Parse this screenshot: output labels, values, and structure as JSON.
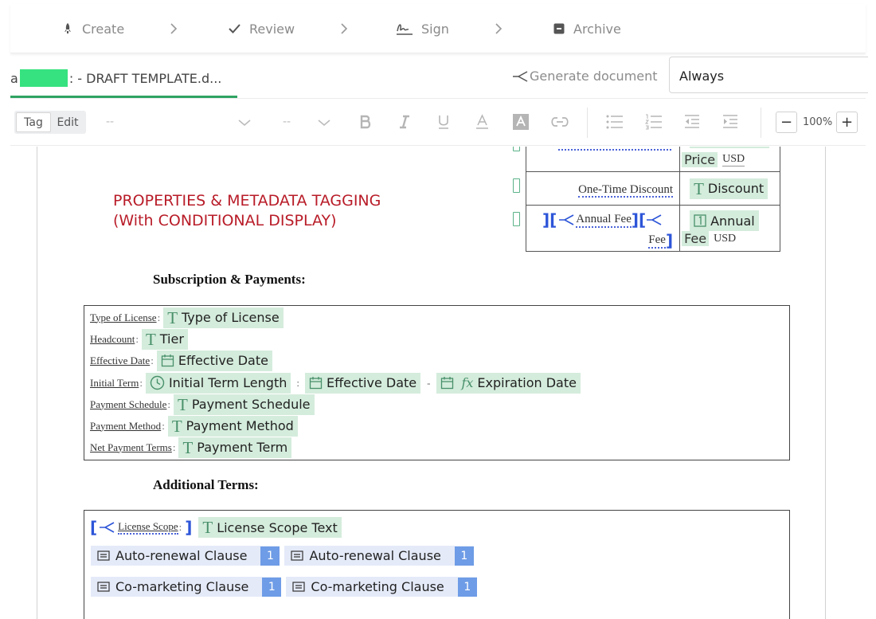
{
  "steps": [
    {
      "label": "Create",
      "icon": "rocket-icon"
    },
    {
      "label": "Review",
      "icon": "check-icon"
    },
    {
      "label": "Sign",
      "icon": "signature-icon"
    },
    {
      "label": "Archive",
      "icon": "archive-icon"
    }
  ],
  "filebar": {
    "file_prefix": "a",
    "file_name": ": - DRAFT TEMPLATE.d...",
    "generate_label": "Generate document",
    "condition_value": "Always"
  },
  "toolbar": {
    "mode_tag": "Tag",
    "mode_edit": "Edit",
    "font_family": "--",
    "font_size": "--",
    "zoom": "100%",
    "zoom_minus": "−",
    "zoom_plus": "+"
  },
  "doc": {
    "heading_line1": "PROPERTIES & METADATA TAGGING",
    "heading_line2": "(With CONDITIONAL DISPLAY)",
    "pricing_table": {
      "row1_tag_label": "Price",
      "row1_currency": "USD",
      "row2_label": "One-Time Discount",
      "row2_tag": "Discount",
      "row3_label": "Annual Fee",
      "row3_label_cont": "Fee",
      "row3_tag_line1": "Annual",
      "row3_tag_line2": "Fee",
      "row3_currency": "USD"
    },
    "subscription": {
      "title": "Subscription & Payments:",
      "rows": [
        {
          "label": "Type of License",
          "tag": "Type of License"
        },
        {
          "label": "Headcount",
          "tag": "Tier"
        },
        {
          "label": "Effective Date",
          "tag": "Effective Date"
        },
        {
          "label": "Initial Term",
          "tag": "Initial Term Length",
          "tag2": "Effective Date",
          "sep": "-",
          "tag3": "Expiration Date"
        },
        {
          "label": "Payment Schedule",
          "tag": "Payment Schedule"
        },
        {
          "label": "Payment Method",
          "tag": "Payment Method"
        },
        {
          "label": "Net Payment Terms",
          "tag": "Payment Term"
        }
      ]
    },
    "additional": {
      "title": "Additional Terms:",
      "scope_label": "License Scope",
      "scope_tag": "License Scope Text",
      "clauses": [
        {
          "label": "Auto-renewal Clause",
          "count": "1"
        },
        {
          "label": "Auto-renewal Clause",
          "count": "1"
        },
        {
          "label": "Co-marketing Clause",
          "count": "1"
        },
        {
          "label": "Co-marketing Clause",
          "count": "1"
        }
      ]
    }
  },
  "colors": {
    "accent_green": "#2fa463",
    "tag_bg": "#d4ecdc",
    "heading_red": "#b81c28",
    "conditional_blue": "#2d55d8",
    "badge_blue": "#6e9ce6"
  }
}
